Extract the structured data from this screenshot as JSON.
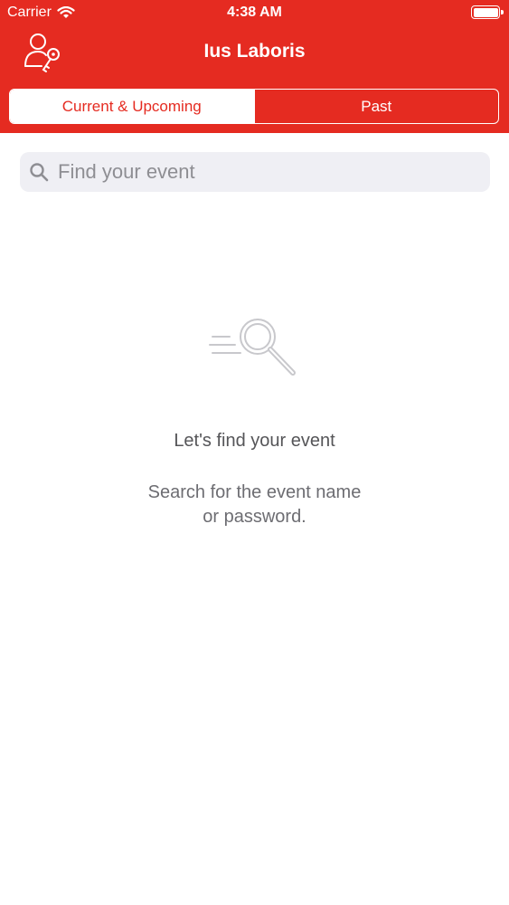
{
  "status_bar": {
    "carrier": "Carrier",
    "time": "4:38 AM",
    "icons": [
      "wifi-icon",
      "battery-icon"
    ]
  },
  "nav": {
    "title": "Ius Laboris",
    "left_icon": "profile-key-icon"
  },
  "tabs": [
    {
      "label": "Current & Upcoming",
      "selected": true
    },
    {
      "label": "Past",
      "selected": false
    }
  ],
  "search": {
    "placeholder": "Find your event",
    "value": "",
    "icon": "search-icon"
  },
  "empty_state": {
    "icon": "search-illustration-icon",
    "title": "Let's find your event",
    "subtitle_line1": "Search for the event name",
    "subtitle_line2": "or password."
  },
  "colors": {
    "brand_red": "#e52b21",
    "search_bg": "#efeff4",
    "placeholder": "#8e8e93"
  }
}
